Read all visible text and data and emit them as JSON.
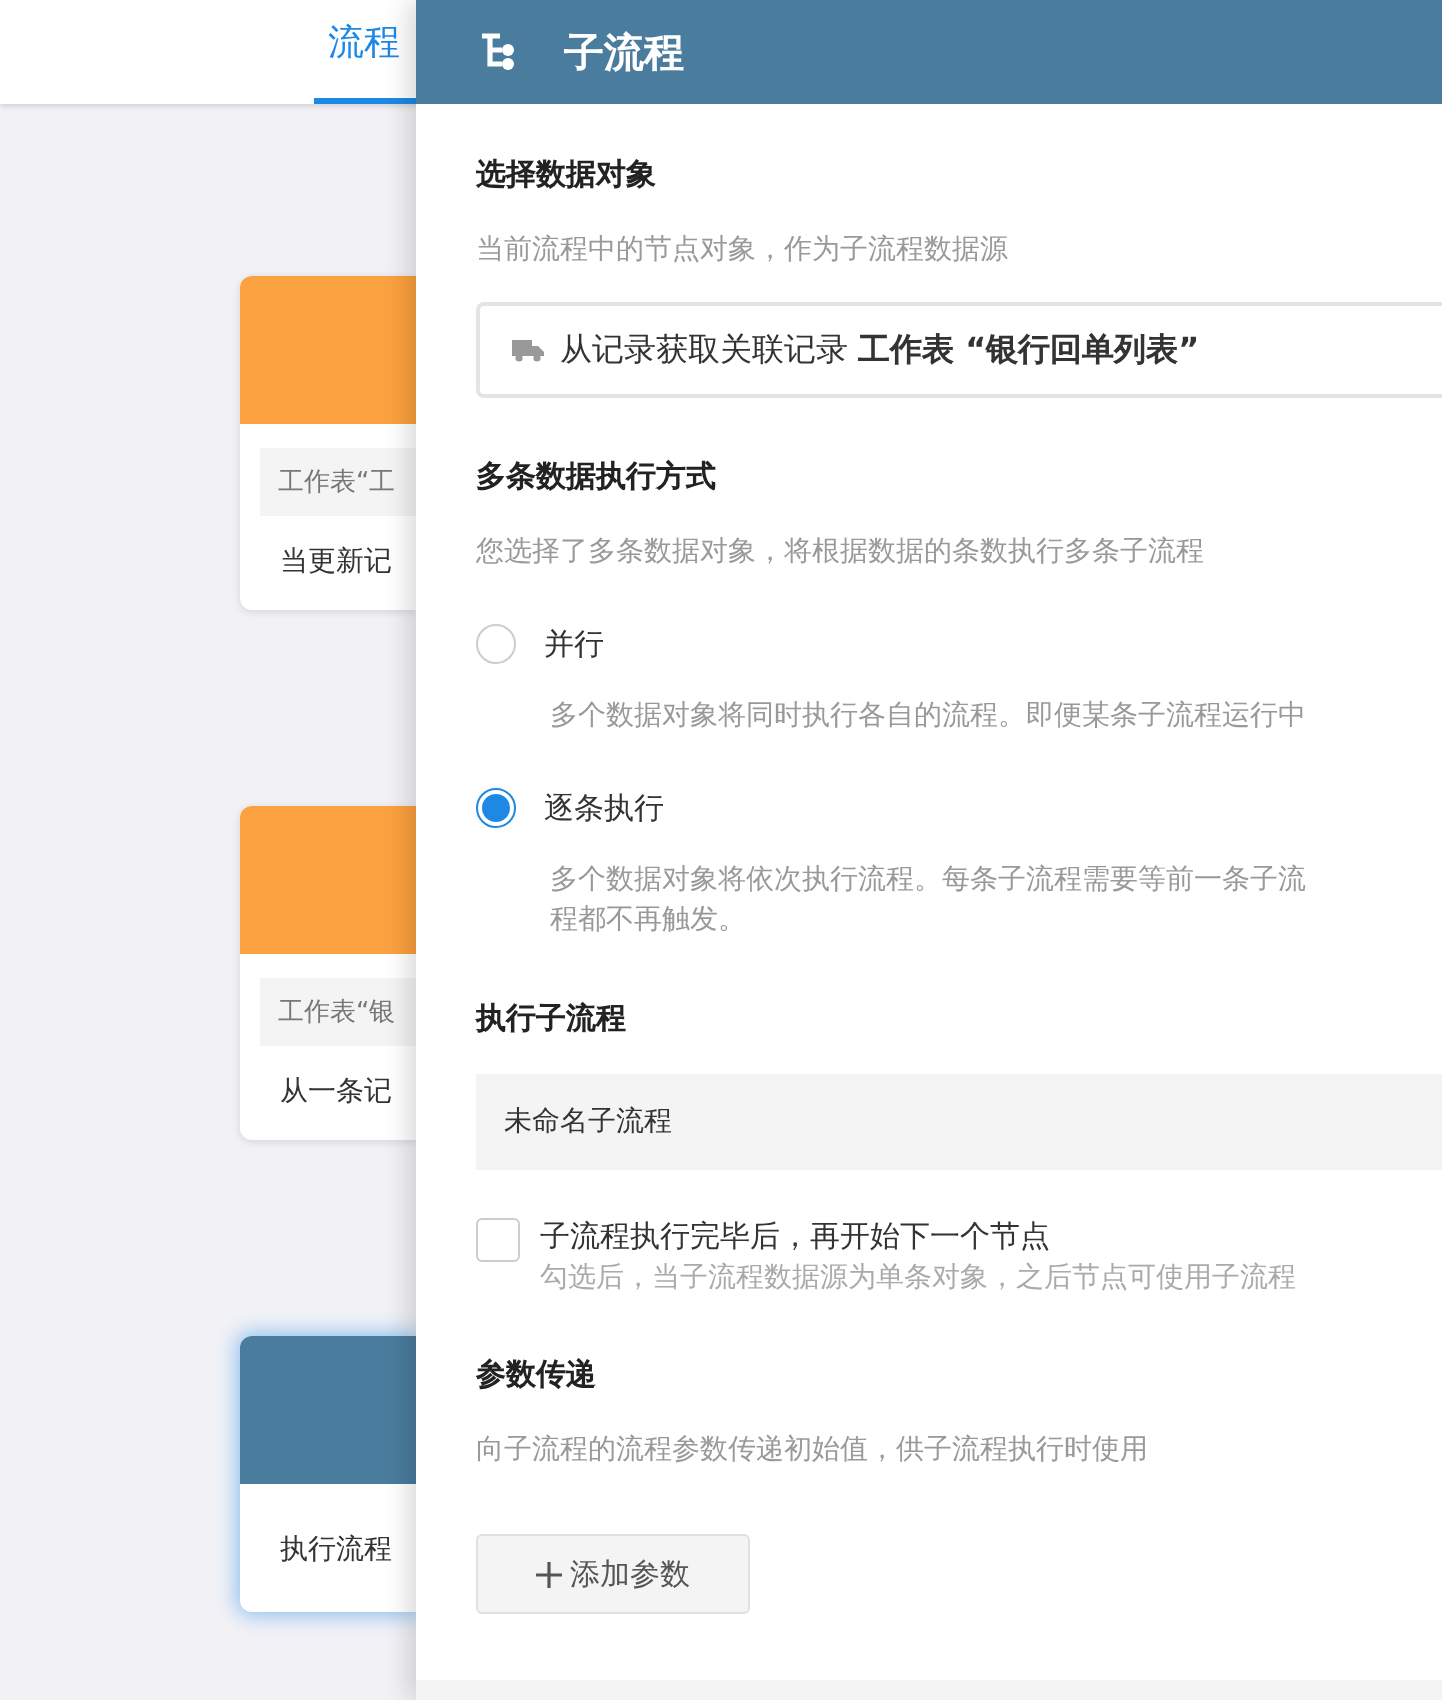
{
  "top_bar": {
    "tabs": [
      {
        "label": "流程",
        "selected": true
      }
    ]
  },
  "nodes": [
    {
      "color": "#fba13f",
      "selected": false,
      "rows": [
        {
          "kind": "chip",
          "text": "工作表“工"
        },
        {
          "kind": "text",
          "text": "当更新记"
        }
      ]
    },
    {
      "color": "#fba13f",
      "selected": false,
      "rows": [
        {
          "kind": "chip",
          "text": "工作表“银"
        },
        {
          "kind": "text",
          "text": "从一条记"
        }
      ]
    },
    {
      "color": "#4a7c9d",
      "selected": true,
      "rows": [
        {
          "kind": "text",
          "text": "执行流程"
        }
      ]
    }
  ],
  "panel": {
    "title": "子流程",
    "sections": [
      {
        "kind": "source",
        "title": "选择数据对象",
        "description": "当前流程中的节点对象，作为子流程数据源",
        "field": {
          "value": "从记录获取关联记录 **工作表 “银行回单列表”**"
        }
      },
      {
        "kind": "mode",
        "title": "多条数据执行方式",
        "description": "您选择了多条数据对象，将根据数据的条数执行多条子流程",
        "options": [
          {
            "label": "并行",
            "selected": false,
            "description": [
              "多个数据对象将同时执行各自的流程。即便某条子流程运行中"
            ]
          },
          {
            "label": "逐条执行",
            "selected": true,
            "description": [
              "多个数据对象将依次执行流程。每条子流程需要等前一条子流",
              "程都不再触发。"
            ]
          }
        ]
      },
      {
        "kind": "subflow",
        "title": "执行子流程",
        "value": "未命名子流程",
        "checkbox": {
          "label": "子流程执行完毕后，再开始下一个节点",
          "checked": false,
          "hint": "勾选后，当子流程数据源为单条对象，之后节点可使用子流程"
        }
      },
      {
        "kind": "params",
        "title": "参数传递",
        "description": "向子流程的流程参数传递初始值，供子流程执行时使用",
        "button": {
          "label": "添加参数"
        }
      }
    ]
  }
}
